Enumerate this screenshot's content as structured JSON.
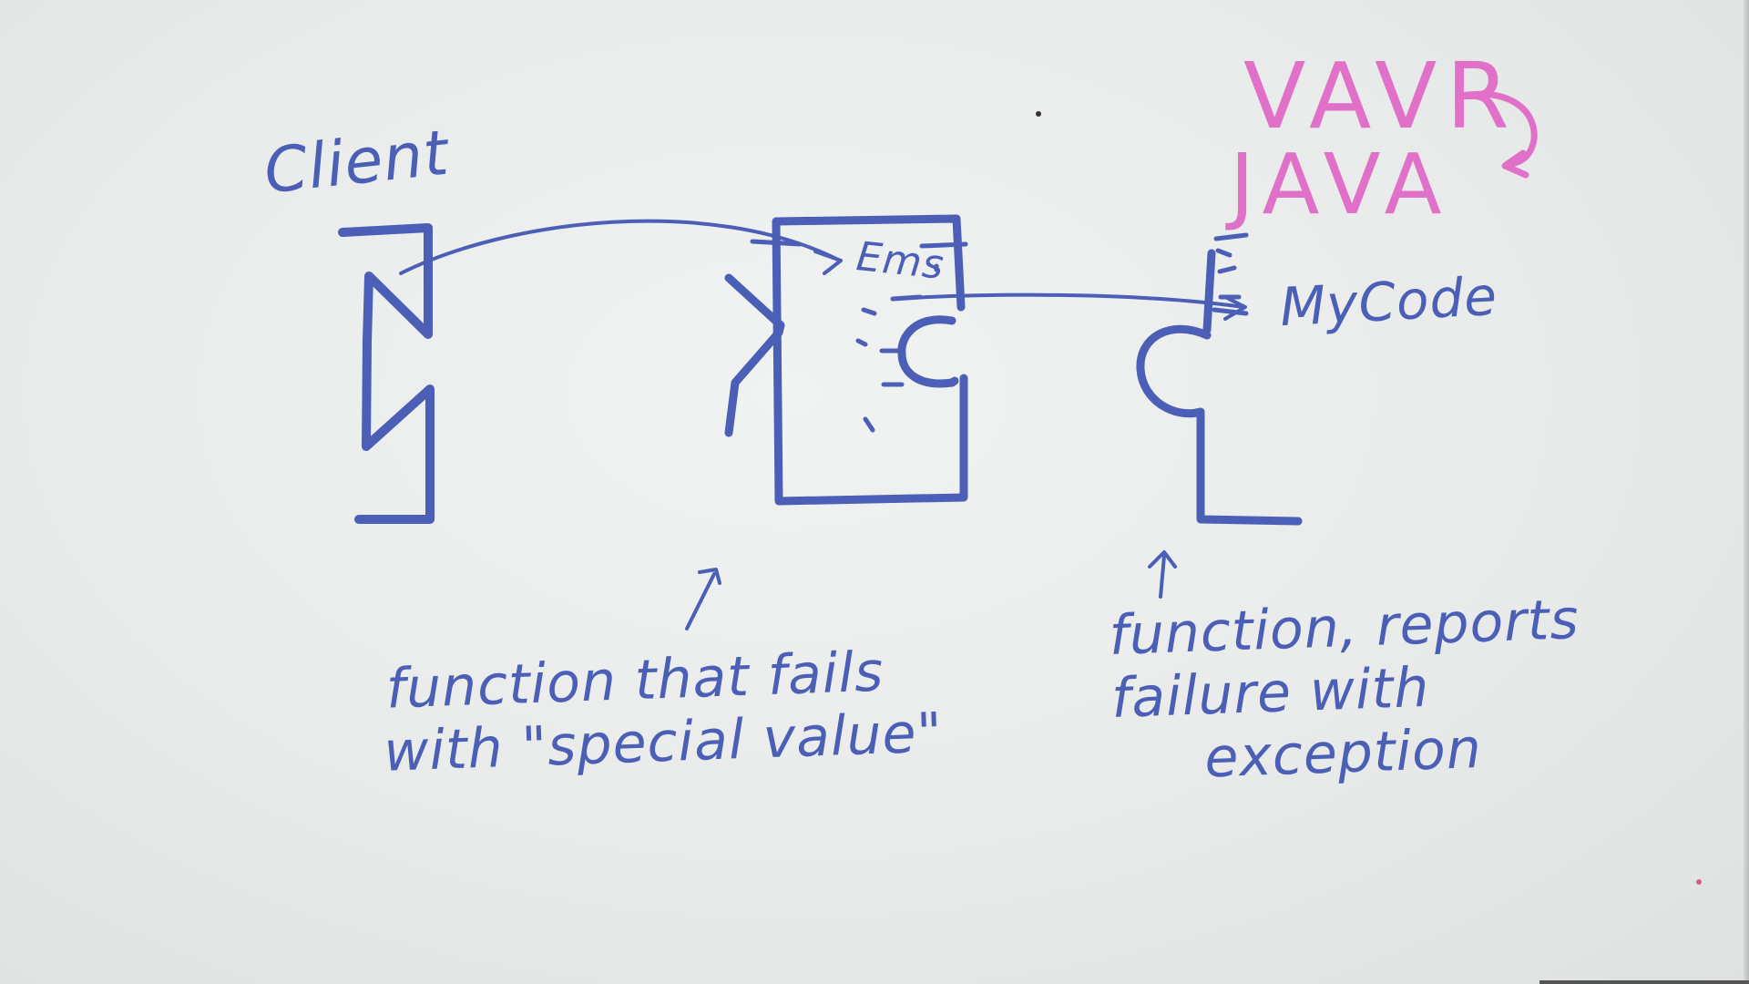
{
  "board": {
    "ink_blue": "#4b5fb6",
    "ink_pink": "#e070c8",
    "background": "#eef0ef"
  },
  "labels": {
    "client": "Client",
    "my_code": "MyCode",
    "ems": "Ems",
    "vavr": "VAVR",
    "java": "JAVA"
  },
  "notes": {
    "left": [
      "function that fails",
      "with \"special value\""
    ],
    "right": [
      "function, reports",
      "failure with",
      "exception"
    ]
  },
  "icons": {
    "client_block": "jigsaw-block-icon",
    "middle_block": "jigsaw-block-icon",
    "mycode_block": "jigsaw-block-icon",
    "connector": "arrow-icon",
    "curl": "curved-arrow-icon"
  }
}
